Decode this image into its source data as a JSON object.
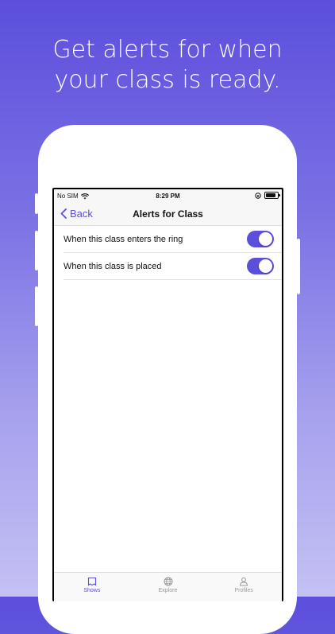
{
  "headline": {
    "line1": "Get alerts for when",
    "line2": "your class is ready."
  },
  "status_bar": {
    "carrier": "No SIM",
    "time": "8:29 PM"
  },
  "nav": {
    "back_label": "Back",
    "title": "Alerts for Class"
  },
  "alerts": [
    {
      "label": "When this class enters the ring",
      "enabled": true
    },
    {
      "label": "When this class is placed",
      "enabled": true
    }
  ],
  "tabs": [
    {
      "label": "Shows",
      "icon": "shows-icon",
      "active": true
    },
    {
      "label": "Explore",
      "icon": "globe-icon",
      "active": false
    },
    {
      "label": "Profiles",
      "icon": "person-icon",
      "active": false
    }
  ],
  "colors": {
    "accent": "#5b4fdc",
    "background_top": "#5b4fdc",
    "background_bottom": "#c4c1f4"
  }
}
